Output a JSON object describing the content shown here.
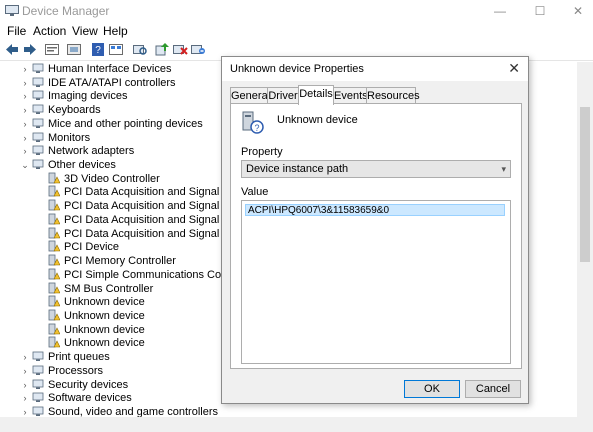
{
  "window": {
    "title": "Device Manager",
    "minimize": "—",
    "maximize": "☐",
    "close": "✕"
  },
  "menu": [
    "File",
    "Action",
    "View",
    "Help"
  ],
  "toolbar_icons": [
    "back-icon",
    "forward-icon",
    "properties-icon",
    "show-hide-icon",
    "help-icon",
    "view-icon",
    "scan-icon",
    "update-driver-icon",
    "uninstall-icon",
    "disable-icon"
  ],
  "tree": [
    {
      "label": "Human Interface Devices",
      "level": 1,
      "expander": "›"
    },
    {
      "label": "IDE ATA/ATAPI controllers",
      "level": 1,
      "expander": "›"
    },
    {
      "label": "Imaging devices",
      "level": 1,
      "expander": "›"
    },
    {
      "label": "Keyboards",
      "level": 1,
      "expander": "›"
    },
    {
      "label": "Mice and other pointing devices",
      "level": 1,
      "expander": "›"
    },
    {
      "label": "Monitors",
      "level": 1,
      "expander": "›"
    },
    {
      "label": "Network adapters",
      "level": 1,
      "expander": "›"
    },
    {
      "label": "Other devices",
      "level": 1,
      "expander": "⌄"
    },
    {
      "label": "3D Video Controller",
      "level": 2
    },
    {
      "label": "PCI Data Acquisition and Signal Process",
      "level": 2
    },
    {
      "label": "PCI Data Acquisition and Signal Process",
      "level": 2
    },
    {
      "label": "PCI Data Acquisition and Signal Process",
      "level": 2
    },
    {
      "label": "PCI Data Acquisition and Signal Process",
      "level": 2
    },
    {
      "label": "PCI Device",
      "level": 2
    },
    {
      "label": "PCI Memory Controller",
      "level": 2
    },
    {
      "label": "PCI Simple Communications Controller",
      "level": 2
    },
    {
      "label": "SM Bus Controller",
      "level": 2
    },
    {
      "label": "Unknown device",
      "level": 2
    },
    {
      "label": "Unknown device",
      "level": 2
    },
    {
      "label": "Unknown device",
      "level": 2
    },
    {
      "label": "Unknown device",
      "level": 2
    },
    {
      "label": "Print queues",
      "level": 1,
      "expander": "›"
    },
    {
      "label": "Processors",
      "level": 1,
      "expander": "›"
    },
    {
      "label": "Security devices",
      "level": 1,
      "expander": "›"
    },
    {
      "label": "Software devices",
      "level": 1,
      "expander": "›"
    },
    {
      "label": "Sound, video and game controllers",
      "level": 1,
      "expander": "›"
    }
  ],
  "dialog": {
    "title": "Unknown device Properties",
    "close": "✕",
    "tabs": [
      "General",
      "Driver",
      "Details",
      "Events",
      "Resources"
    ],
    "active_tab": "Details",
    "device_name": "Unknown device",
    "property_label": "Property",
    "property_value": "Device instance path",
    "value_label": "Value",
    "value_text": "ACPI\\HPQ6007\\3&11583659&0",
    "ok": "OK",
    "cancel": "Cancel"
  },
  "colors": {
    "accent": "#0078d7",
    "selection": "#cce8ff",
    "warning": "#f2c12e"
  }
}
